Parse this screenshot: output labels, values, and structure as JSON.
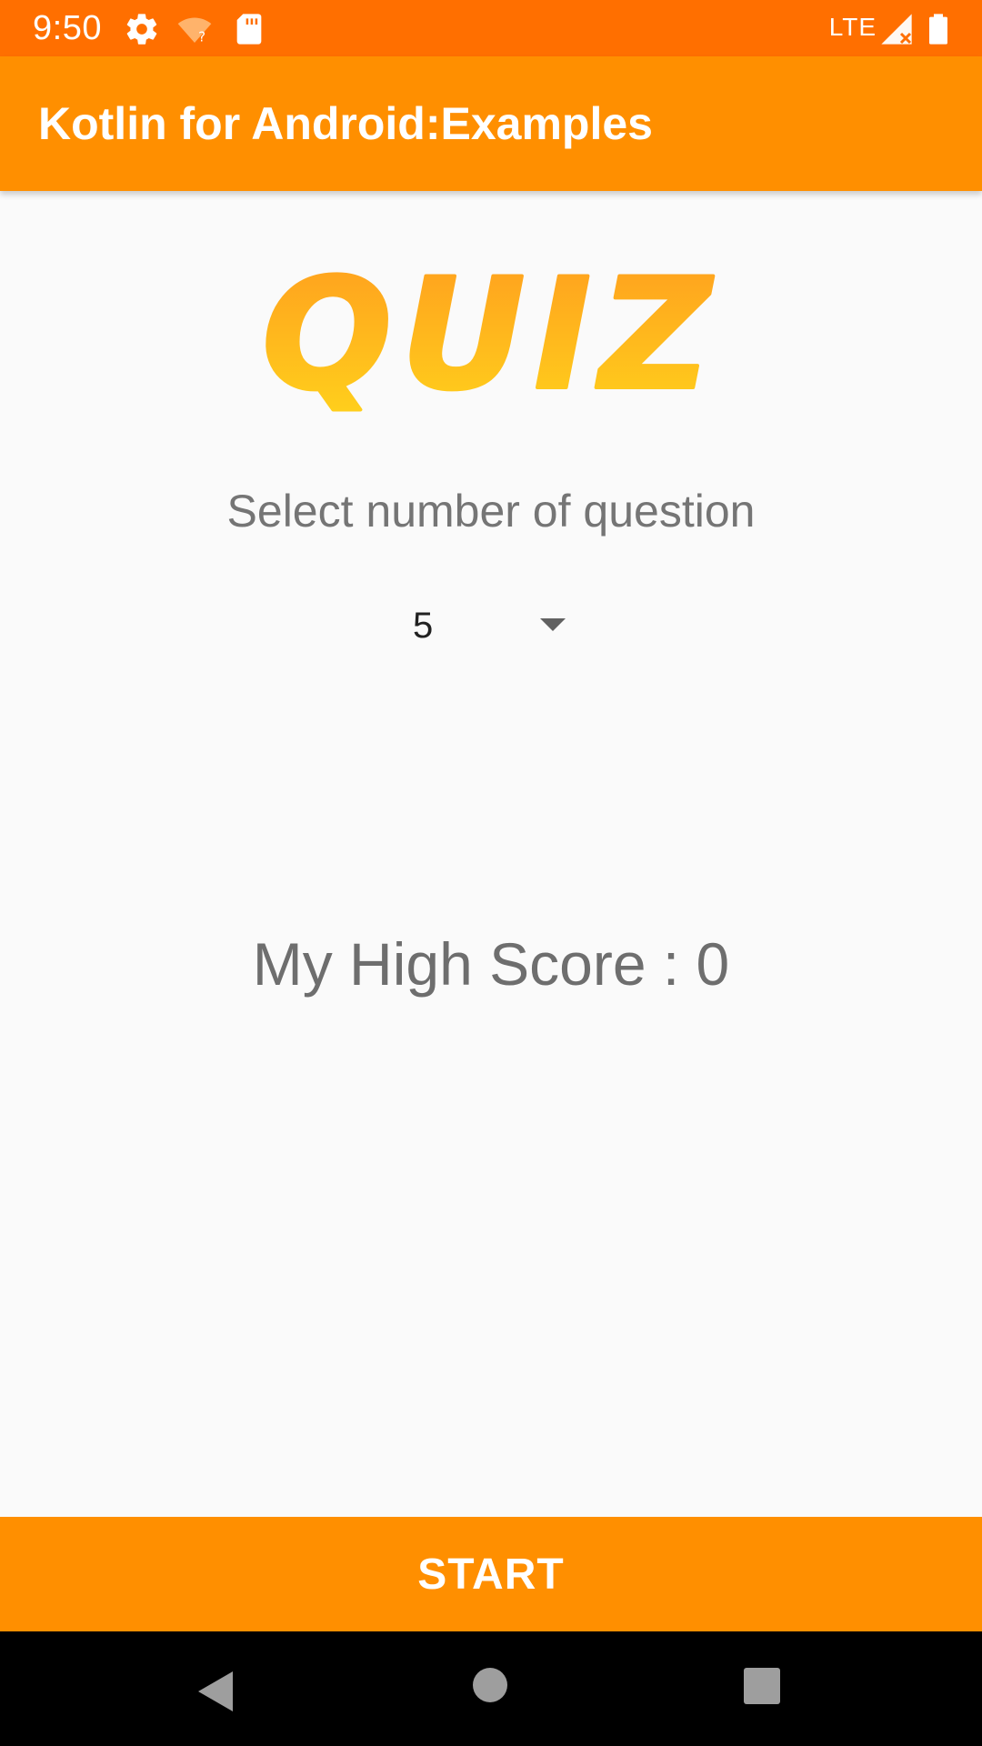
{
  "status_bar": {
    "time": "9:50",
    "network": "LTE",
    "icons": [
      "settings-icon",
      "wifi-unknown-icon",
      "sd-card-icon",
      "signal-icon",
      "battery-icon"
    ]
  },
  "app_bar": {
    "title": "Kotlin for Android:Examples"
  },
  "logo": {
    "text": "QUIZ"
  },
  "question_select": {
    "label": "Select number of question",
    "selected_value": "5"
  },
  "high_score": {
    "text": "My High Score : 0"
  },
  "start_button": {
    "label": "START"
  },
  "nav_bar": {
    "icons": [
      "back-icon",
      "home-icon",
      "recents-icon"
    ]
  },
  "colors": {
    "status_bar": "#ff6f00",
    "primary": "#ff8f00",
    "background": "#fafafa",
    "logo_top": "#ff9d1e",
    "logo_bottom": "#ffd21c"
  }
}
